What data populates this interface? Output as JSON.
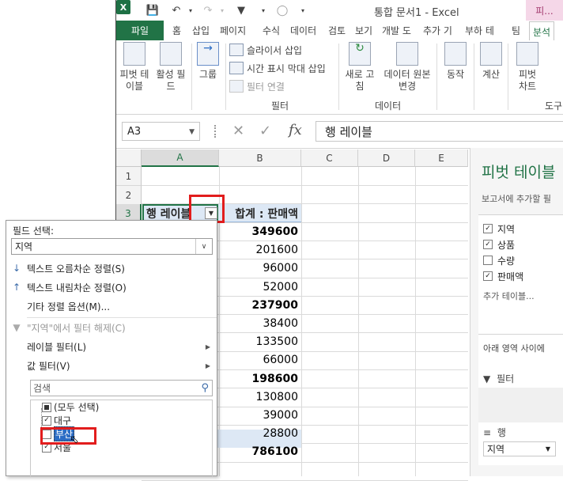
{
  "window": {
    "title": "통합 문서1 - Excel",
    "context_tab_label": "피...",
    "logo_text": "X"
  },
  "tabs": [
    "파일",
    "홈",
    "삽입",
    "페이지",
    "수식",
    "데이터",
    "검토",
    "보기",
    "개발 도",
    "추가 기",
    "부하 테",
    "팀",
    "분석"
  ],
  "ribbon": {
    "pivot_table": "피벗 테\n이블",
    "active_field": "활성 필\n드",
    "group": "그룹",
    "insert_slicer": "슬라이서 삽입",
    "insert_timeline": "시간 표시 막대 삽입",
    "filter_connections": "필터 연결",
    "filter_group_label": "필터",
    "refresh": "새로 고\n침",
    "change_source": "데이터 원본\n변경",
    "data_group_label": "데이터",
    "actions": "동작",
    "calculations": "계산",
    "pivot_chart": "피벗\n차트",
    "tools_group_label": "도구"
  },
  "formula_bar": {
    "name_box": "A3",
    "formula": "행 레이블",
    "fx_label": "fx"
  },
  "columns": [
    "A",
    "B",
    "C",
    "D",
    "E"
  ],
  "rows": [
    "1",
    "2",
    "3"
  ],
  "pivot": {
    "header_row_label": "행 레이블",
    "header_value": "합계 : 판매액",
    "values": [
      {
        "v": "349600",
        "bold": true
      },
      {
        "v": "201600",
        "bold": false
      },
      {
        "v": "96000",
        "bold": false
      },
      {
        "v": "52000",
        "bold": false
      },
      {
        "v": "237900",
        "bold": true
      },
      {
        "v": "38400",
        "bold": false
      },
      {
        "v": "133500",
        "bold": false
      },
      {
        "v": "66000",
        "bold": false
      },
      {
        "v": "198600",
        "bold": true
      },
      {
        "v": "130800",
        "bold": false
      },
      {
        "v": "39000",
        "bold": false
      },
      {
        "v": "28800",
        "bold": false
      },
      {
        "v": "786100",
        "bold": true
      }
    ]
  },
  "dropdown": {
    "field_select_label": "필드 선택:",
    "field_select_value": "지역",
    "menu": {
      "sort_asc": "텍스트 오름차순 정렬(S)",
      "sort_desc": "텍스트 내림차순 정렬(O)",
      "more_sort": "기타 정렬 옵션(M)...",
      "clear_filter": "\"지역\"에서 필터 해제(C)",
      "label_filter": "레이블 필터(L)",
      "value_filter": "값 필터(V)"
    },
    "search_placeholder": "검색",
    "list": {
      "select_all": "(모두 선택)",
      "daegu": "대구",
      "busan": "부산",
      "seoul": "서울"
    }
  },
  "pivot_pane": {
    "title": "피벗 테이블",
    "subtitle": "보고서에 추가할 필",
    "fields": [
      {
        "label": "지역",
        "checked": true
      },
      {
        "label": "상품",
        "checked": true
      },
      {
        "label": "수량",
        "checked": false
      },
      {
        "label": "판매액",
        "checked": true
      }
    ],
    "more_tables": "추가 테이블...",
    "area_hint": "아래 영역 사이에 ",
    "filter_area": "필터",
    "rows_area": "행",
    "rows_field": "지역"
  },
  "colors": {
    "excel_green": "#217346",
    "highlight_red": "#e21d1d",
    "pivot_header_fill": "#dde8f5",
    "selection_blue": "#2b6cc4"
  }
}
